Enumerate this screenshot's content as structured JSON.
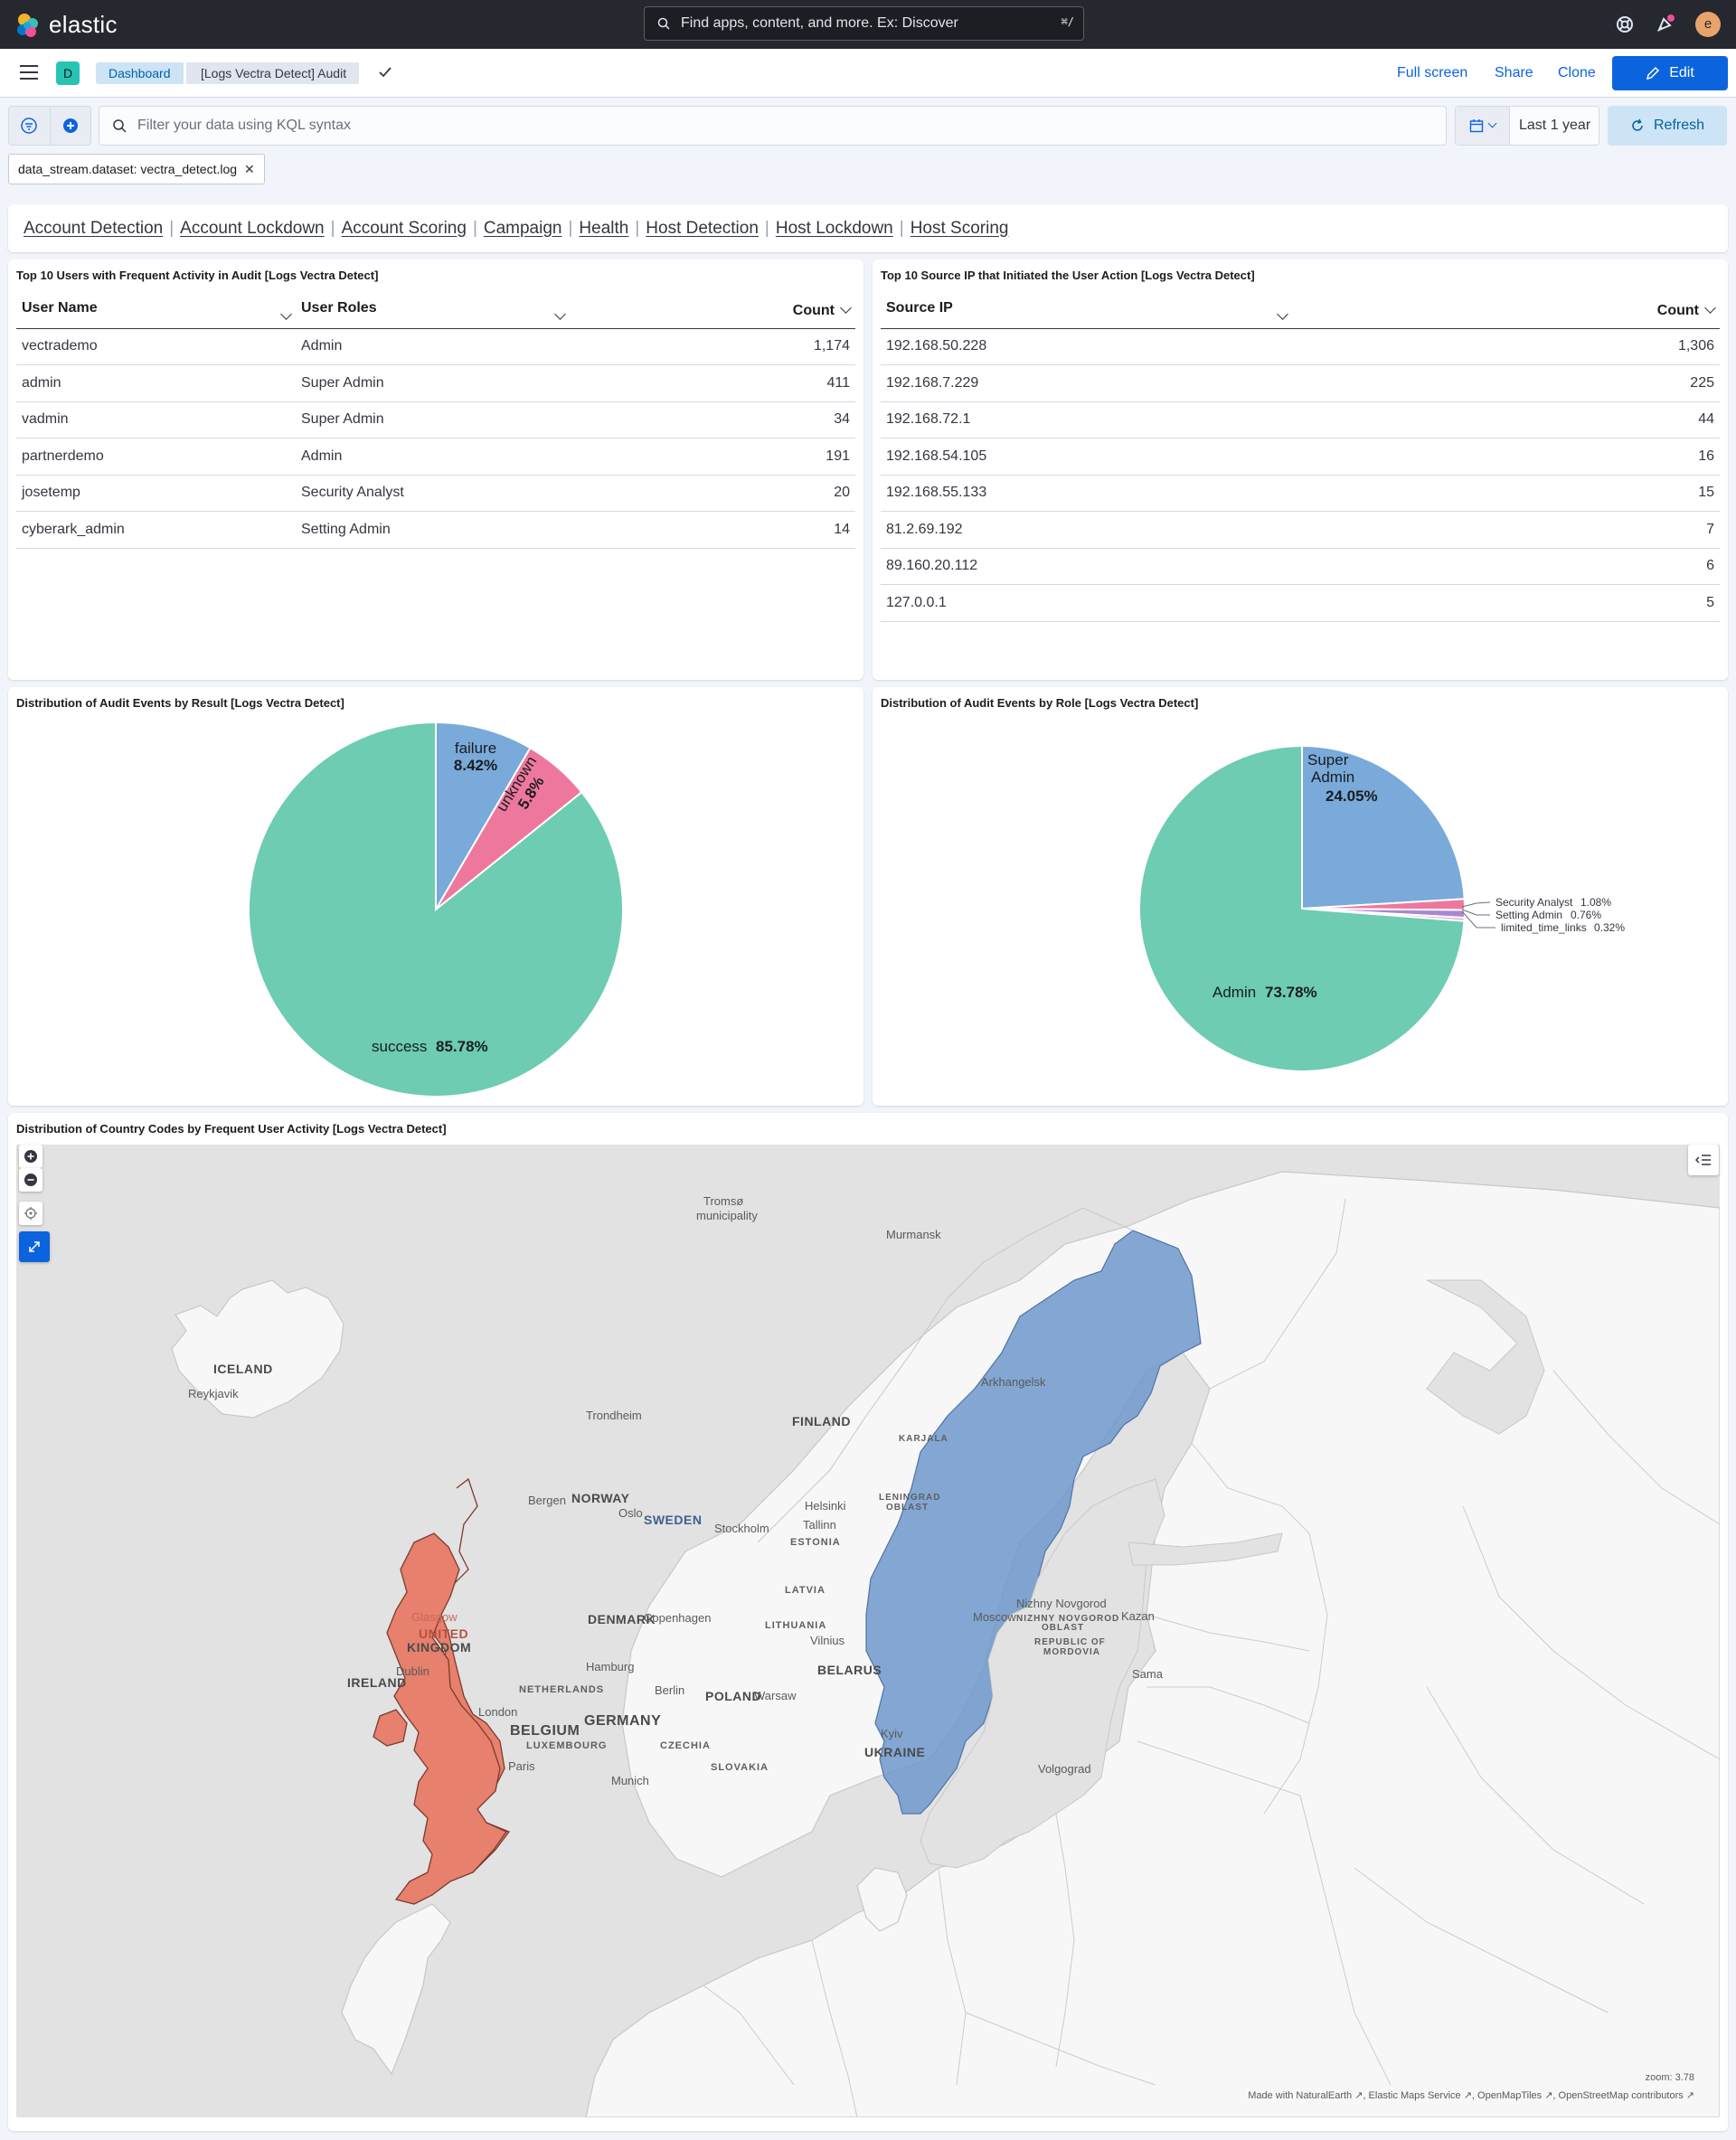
{
  "header": {
    "logo_text": "elastic",
    "search_placeholder": "Find apps, content, and more. Ex: Discover",
    "search_shortcut": "⌘/",
    "avatar_letter": "e"
  },
  "nav": {
    "space_letter": "D",
    "breadcrumb_root": "Dashboard",
    "breadcrumb_current": "[Logs Vectra Detect] Audit",
    "full_screen": "Full screen",
    "share": "Share",
    "clone": "Clone",
    "edit": "Edit"
  },
  "query": {
    "kql_placeholder": "Filter your data using KQL syntax",
    "time_range": "Last 1 year",
    "refresh": "Refresh",
    "filter_pill": "data_stream.dataset: vectra_detect.log"
  },
  "links": [
    "Account Detection",
    "Account Lockdown",
    "Account Scoring",
    "Campaign",
    "Health",
    "Host Detection",
    "Host Lockdown",
    "Host Scoring"
  ],
  "users_table": {
    "title": "Top 10 Users with Frequent Activity in Audit [Logs Vectra Detect]",
    "headers": [
      "User Name",
      "User Roles",
      "Count"
    ],
    "rows": [
      [
        "vectrademo",
        "Admin",
        "1,174"
      ],
      [
        "admin",
        "Super Admin",
        "411"
      ],
      [
        "vadmin",
        "Super Admin",
        "34"
      ],
      [
        "partnerdemo",
        "Admin",
        "191"
      ],
      [
        "josetemp",
        "Security Analyst",
        "20"
      ],
      [
        "cyberark_admin",
        "Setting Admin",
        "14"
      ]
    ]
  },
  "ip_table": {
    "title": "Top 10 Source IP that Initiated the User Action [Logs Vectra Detect]",
    "headers": [
      "Source IP",
      "Count"
    ],
    "rows": [
      [
        "192.168.50.228",
        "1,306"
      ],
      [
        "192.168.7.229",
        "225"
      ],
      [
        "192.168.72.1",
        "44"
      ],
      [
        "192.168.54.105",
        "16"
      ],
      [
        "192.168.55.133",
        "15"
      ],
      [
        "81.2.69.192",
        "7"
      ],
      [
        "89.160.20.112",
        "6"
      ],
      [
        "127.0.0.1",
        "5"
      ]
    ]
  },
  "result_pie": {
    "title": "Distribution of Audit Events by Result [Logs Vectra Detect]",
    "colors": [
      "#79aad9",
      "#ee789d",
      "#6dccb1"
    ],
    "slices": [
      {
        "label": "failure",
        "pct": "8.42%",
        "value": 8.42
      },
      {
        "label": "unknown",
        "pct": "5.8%",
        "value": 5.8
      },
      {
        "label": "success",
        "pct": "85.78%",
        "value": 85.78
      }
    ]
  },
  "role_pie": {
    "title": "Distribution of Audit Events by Role [Logs Vectra Detect]",
    "colors": [
      "#79aad9",
      "#ee789d",
      "#a987d1",
      "#e4a6c7",
      "#6dccb1"
    ],
    "slices": [
      {
        "label": "Super Admin",
        "pct": "24.05%",
        "value": 24.05
      },
      {
        "label": "Security Analyst",
        "pct": "1.08%",
        "value": 1.08
      },
      {
        "label": "Setting Admin",
        "pct": "0.76%",
        "value": 0.76
      },
      {
        "label": "limited_time_links",
        "pct": "0.32%",
        "value": 0.32
      },
      {
        "label": "Admin",
        "pct": "73.78%",
        "value": 73.78
      }
    ]
  },
  "map": {
    "title": "Distribution of Country Codes by Frequent User Activity [Logs Vectra Detect]",
    "zoom_text": "zoom: 3.78",
    "attribution": "Made with NaturalEarth ↗, Elastic Maps Service ↗, OpenMapTiles ↗, OpenStreetMap contributors ↗",
    "highlight_colors": {
      "sweden": "#6f98cc",
      "uk": "#e7806c"
    },
    "labels": [
      "Tromsø",
      "municipality",
      "Murmansk",
      "ICELAND",
      "Reykjavik",
      "Arkhangelsk",
      "FINLAND",
      "KARJALA",
      "Trondheim",
      "Bergen",
      "NORWAY",
      "Oslo",
      "SWEDEN",
      "Stockholm",
      "Helsinki",
      "Tallinn",
      "ESTONIA",
      "LENINGRAD",
      "OBLAST",
      "LATVIA",
      "Nizhny Novgorod",
      "Moscow",
      "NIZHNY NOVGOROD",
      "OBLAST",
      "Kazan",
      "DENMARK",
      "Copenhagen",
      "LITHUANIA",
      "Vilnius",
      "REPUBLIC OF",
      "MORDOVIA",
      "Glasgow",
      "UNITED",
      "KINGDOM",
      "Dublin",
      "IRELAND",
      "Hamburg",
      "BELARUS",
      "Sama",
      "NETHERLANDS",
      "Berlin",
      "POLAND",
      "Warsaw",
      "London",
      "BELGIUM",
      "GERMANY",
      "LUXEMBOURG",
      "CZECHIA",
      "Kyiv",
      "UKRAINE",
      "Paris",
      "Munich",
      "SLOVAKIA",
      "Volgograd"
    ]
  }
}
